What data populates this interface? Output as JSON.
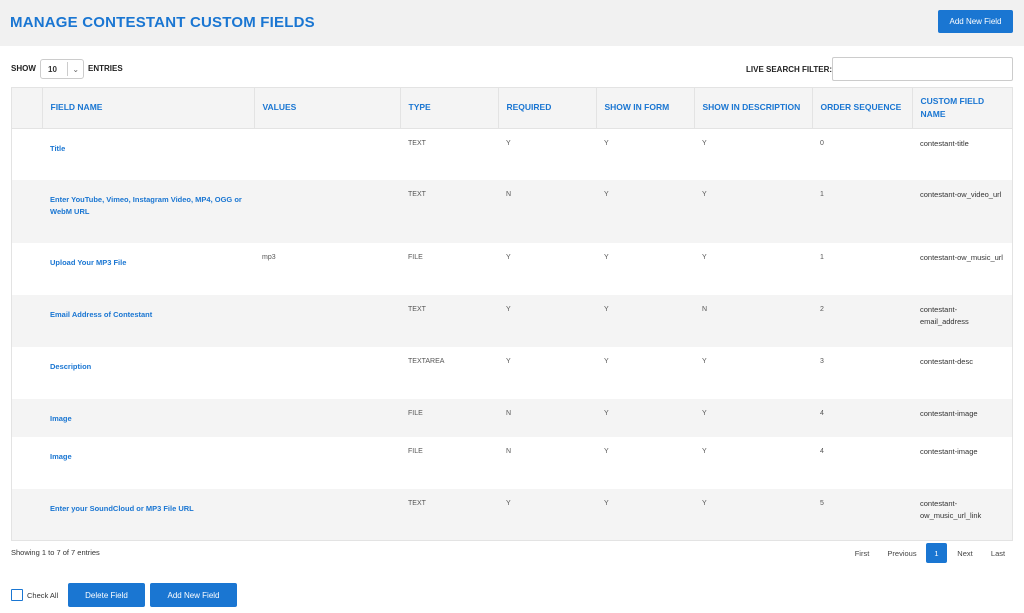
{
  "header": {
    "title": "MANAGE CONTESTANT CUSTOM FIELDS",
    "add_button": "Add New Field"
  },
  "controls": {
    "show_label": "SHOW",
    "entries_value": "10",
    "entries_label": "ENTRIES",
    "search_label": "LIVE SEARCH FILTER:",
    "search_value": ""
  },
  "table": {
    "columns": [
      "FIELD NAME",
      "VALUES",
      "TYPE",
      "REQUIRED",
      "SHOW IN FORM",
      "SHOW IN DESCRIPTION",
      "ORDER SEQUENCE",
      "CUSTOM FIELD NAME"
    ],
    "rows": [
      {
        "name": "Title",
        "values": "",
        "type": "TEXT",
        "required": "Y",
        "show_form": "Y",
        "show_desc": "Y",
        "order": "0",
        "custom": "contestant-title"
      },
      {
        "name": "Enter YouTube, Vimeo, Instagram Video, MP4, OGG or WebM URL",
        "values": "",
        "type": "TEXT",
        "required": "N",
        "show_form": "Y",
        "show_desc": "Y",
        "order": "1",
        "custom": "contestant-ow_video_url"
      },
      {
        "name": "Upload Your MP3 File",
        "values": "mp3",
        "type": "FILE",
        "required": "Y",
        "show_form": "Y",
        "show_desc": "Y",
        "order": "1",
        "custom": "contestant-ow_music_url"
      },
      {
        "name": "Email Address of Contestant",
        "values": "",
        "type": "TEXT",
        "required": "Y",
        "show_form": "Y",
        "show_desc": "N",
        "order": "2",
        "custom": "contestant-email_address"
      },
      {
        "name": "Description",
        "values": "",
        "type": "TEXTAREA",
        "required": "Y",
        "show_form": "Y",
        "show_desc": "Y",
        "order": "3",
        "custom": "contestant-desc"
      },
      {
        "name": "Image",
        "values": "",
        "type": "FILE",
        "required": "N",
        "show_form": "Y",
        "show_desc": "Y",
        "order": "4",
        "custom": "contestant-image"
      },
      {
        "name": "Image",
        "values": "",
        "type": "FILE",
        "required": "N",
        "show_form": "Y",
        "show_desc": "Y",
        "order": "4",
        "custom": "contestant-image"
      },
      {
        "name": "Enter your SoundCloud or MP3 File URL",
        "values": "",
        "type": "TEXT",
        "required": "Y",
        "show_form": "Y",
        "show_desc": "Y",
        "order": "5",
        "custom": "contestant-ow_music_url_link"
      }
    ]
  },
  "footer": {
    "info": "Showing 1 to 7 of 7 entries",
    "first": "First",
    "previous": "Previous",
    "page": "1",
    "next": "Next",
    "last": "Last"
  },
  "actions": {
    "check_all": "Check All",
    "delete": "Delete Field",
    "add": "Add New Field"
  },
  "colors": {
    "accent": "#1a76d2"
  },
  "icons": {
    "select_chevron": "chevron-down-icon",
    "check_box": "checkbox-icon"
  }
}
